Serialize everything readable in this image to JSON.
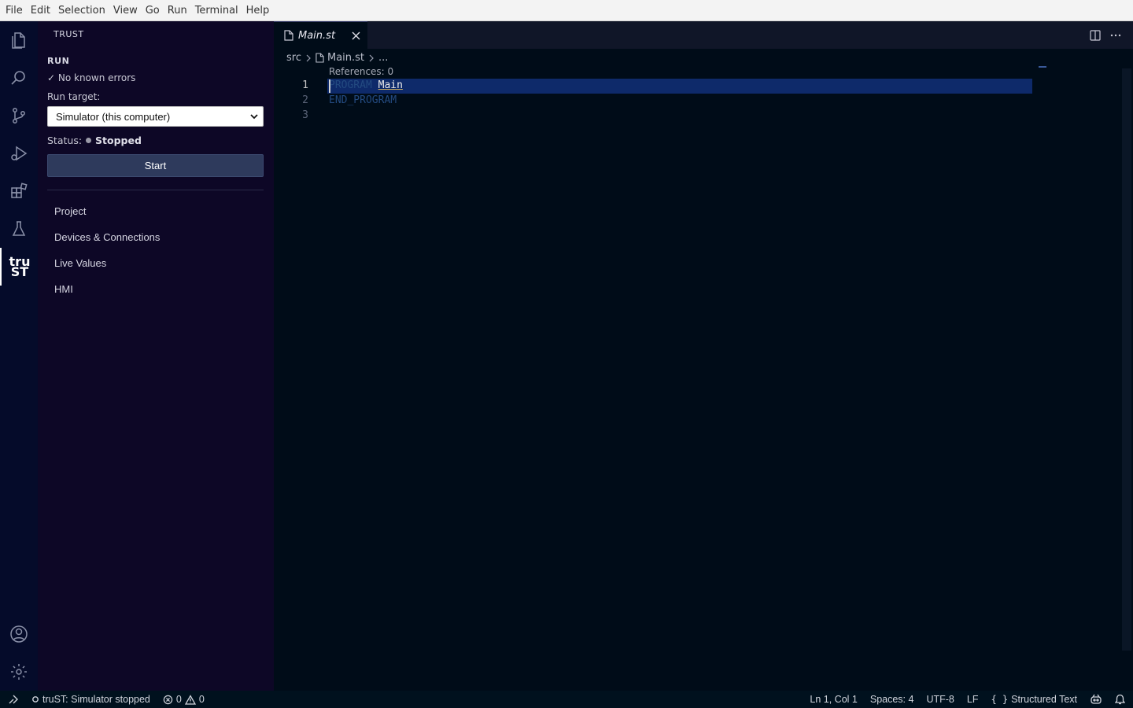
{
  "menu": [
    "File",
    "Edit",
    "Selection",
    "View",
    "Go",
    "Run",
    "Terminal",
    "Help"
  ],
  "activity_bar": {
    "icons": [
      "files-icon",
      "search-icon",
      "source-control-icon",
      "run-debug-icon",
      "extensions-icon",
      "testing-icon",
      "trust-extension-icon"
    ],
    "trust_logo_line1": "tru",
    "trust_logo_line2": "ST",
    "bottom_icons": [
      "account-icon",
      "settings-gear-icon"
    ]
  },
  "sidebar": {
    "title": "TRUST",
    "section": "RUN",
    "check_text": "✓ No known errors",
    "run_target_label": "Run target:",
    "run_target_value": "Simulator (this computer)",
    "status_label": "Status:",
    "status_value": "Stopped",
    "start_button": "Start",
    "nav": [
      "Project",
      "Devices & Connections",
      "Live Values",
      "HMI"
    ]
  },
  "editor": {
    "tab_name": "Main.st",
    "breadcrumb": [
      "src",
      "Main.st",
      "..."
    ],
    "codelens": "References: 0",
    "lines": [
      {
        "num": "1",
        "keyword": "PROGRAM",
        "ident": "Main"
      },
      {
        "num": "2",
        "keyword": "END_PROGRAM",
        "ident": ""
      },
      {
        "num": "3",
        "keyword": "",
        "ident": ""
      }
    ]
  },
  "statusbar": {
    "remote_icon": "remote-icon",
    "simulator": "truST: Simulator stopped",
    "errors": "0",
    "warnings": "0",
    "position": "Ln 1, Col 1",
    "spaces": "Spaces: 4",
    "encoding": "UTF-8",
    "eol": "LF",
    "language": "Structured Text"
  },
  "colors": {
    "editor_bg": "#000c18",
    "sidebar_bg": "#0d0726",
    "activitybar_bg": "#050b2a",
    "line_highlight": "#0e2a6a",
    "keyword": "#234a80",
    "start_button": "#2e3a5c"
  }
}
